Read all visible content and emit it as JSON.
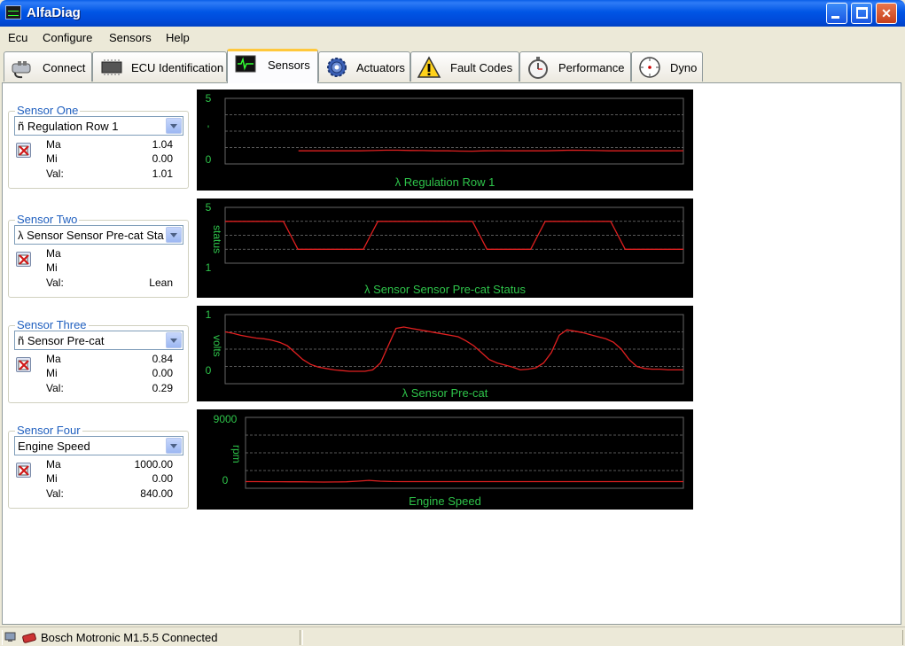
{
  "window": {
    "title": "AlfaDiag"
  },
  "menu": {
    "items": [
      "Ecu",
      "Configure",
      "Sensors",
      "Help"
    ]
  },
  "tabs": [
    {
      "label": "Connect",
      "icon": "plug-icon"
    },
    {
      "label": "ECU Identification",
      "icon": "chip-icon"
    },
    {
      "label": "Sensors",
      "icon": "oscilloscope-icon"
    },
    {
      "label": "Actuators",
      "icon": "gear-icon"
    },
    {
      "label": "Fault Codes",
      "icon": "warning-icon"
    },
    {
      "label": "Performance",
      "icon": "stopwatch-icon"
    },
    {
      "label": "Dyno",
      "icon": "dial-icon"
    }
  ],
  "active_tab": "Sensors",
  "sensors": [
    {
      "group_title": "Sensor One",
      "selected": "ñ Regulation Row 1",
      "ma_label": "Ma",
      "mi_label": "Mi",
      "val_label": "Val:",
      "ma": "1.04",
      "mi": "0.00",
      "val": "1.01"
    },
    {
      "group_title": "Sensor Two",
      "selected": "λ Sensor Sensor Pre-cat Status",
      "ma_label": "Ma",
      "mi_label": "Mi",
      "val_label": "Val:",
      "ma": "",
      "mi": "",
      "val": "Lean"
    },
    {
      "group_title": "Sensor Three",
      "selected": "ñ Sensor Pre-cat",
      "ma_label": "Ma",
      "mi_label": "Mi",
      "val_label": "Val:",
      "ma": "0.84",
      "mi": "0.00",
      "val": "0.29"
    },
    {
      "group_title": "Sensor Four",
      "selected": "Engine Speed",
      "ma_label": "Ma",
      "mi_label": "Mi",
      "val_label": "Val:",
      "ma": "1000.00",
      "mi": "0.00",
      "val": "840.00"
    }
  ],
  "charts": [
    {
      "title": "λ Regulation Row 1",
      "y_max_label": "5",
      "y_mid_label": "'",
      "y_min_label": "0",
      "y_axis_label": ""
    },
    {
      "title": "λ Sensor Sensor Pre-cat Status",
      "y_max_label": "5",
      "y_min_label": "1",
      "y_axis_label": "status"
    },
    {
      "title": "λ Sensor Pre-cat",
      "y_max_label": "1",
      "y_min_label": "0",
      "y_axis_label": "volts"
    },
    {
      "title": "Engine Speed",
      "y_max_label": "9000",
      "y_min_label": "0",
      "y_axis_label": "rpm"
    }
  ],
  "chart_data": [
    {
      "type": "line",
      "title": "λ Regulation Row 1",
      "ylim": [
        0,
        5
      ],
      "grid": true,
      "series": [
        {
          "values": [
            1.0,
            1.0,
            1.0,
            1.0,
            1.0,
            1.0,
            1.02,
            1.05,
            1.05,
            1.03,
            1.02,
            1.0,
            1.0,
            0.98,
            0.97,
            1.0,
            1.01,
            1.0,
            1.0,
            1.0,
            1.0,
            1.03,
            1.05,
            1.04,
            1.02,
            1.0,
            1.0,
            1.0,
            1.0,
            1.0,
            1.0,
            1.01
          ]
        }
      ],
      "line_color": "#e02020",
      "start_fraction": 0.16
    },
    {
      "type": "line",
      "title": "λ Sensor Sensor Pre-cat Status",
      "ylim": [
        1,
        5
      ],
      "grid": true,
      "series": [
        {
          "values": [
            4,
            4,
            4,
            4,
            4,
            4,
            4,
            4,
            4,
            3,
            2,
            2,
            2,
            2,
            2,
            2,
            2,
            2,
            2,
            2,
            3,
            4,
            4,
            4,
            4,
            4,
            4,
            4,
            4,
            4,
            4,
            4,
            4,
            4,
            4,
            3,
            2,
            2,
            2,
            2,
            2,
            2,
            2,
            3,
            4,
            4,
            4,
            4,
            4,
            4,
            4,
            4,
            4,
            4,
            3,
            2,
            2,
            2,
            2,
            2,
            2,
            2,
            2,
            2
          ]
        }
      ],
      "line_color": "#e02020"
    },
    {
      "type": "line",
      "title": "λ Sensor Pre-cat",
      "ylim": [
        0,
        1
      ],
      "grid": true,
      "series": [
        {
          "values": [
            0.75,
            0.73,
            0.7,
            0.68,
            0.66,
            0.65,
            0.63,
            0.6,
            0.55,
            0.45,
            0.35,
            0.28,
            0.24,
            0.22,
            0.2,
            0.19,
            0.18,
            0.18,
            0.18,
            0.2,
            0.3,
            0.55,
            0.8,
            0.82,
            0.8,
            0.78,
            0.76,
            0.74,
            0.72,
            0.7,
            0.68,
            0.62,
            0.55,
            0.45,
            0.35,
            0.3,
            0.27,
            0.24,
            0.2,
            0.21,
            0.23,
            0.3,
            0.45,
            0.7,
            0.78,
            0.76,
            0.74,
            0.71,
            0.68,
            0.65,
            0.6,
            0.5,
            0.35,
            0.25,
            0.22,
            0.21,
            0.21,
            0.2,
            0.2,
            0.2
          ]
        }
      ],
      "line_color": "#e02020"
    },
    {
      "type": "line",
      "title": "Engine Speed",
      "ylim": [
        0,
        9000
      ],
      "grid": true,
      "series": [
        {
          "values": [
            840,
            840,
            830,
            830,
            820,
            820,
            800,
            790,
            800,
            820,
            900,
            1000,
            900,
            850,
            840,
            840,
            840,
            840,
            840,
            840,
            840,
            840,
            840,
            840,
            840,
            840,
            840,
            840,
            840,
            840,
            840,
            840,
            840,
            840,
            840,
            840,
            840,
            840,
            840,
            840
          ]
        }
      ],
      "line_color": "#e02020"
    }
  ],
  "status": {
    "text": "Bosch Motronic M1.5.5 Connected"
  },
  "colors": {
    "chart_bg": "#000000",
    "chart_text": "#2ec44a",
    "chart_grid": "#555555",
    "line": "#e02020",
    "group_title": "#1f5fbf",
    "active_tab_accent": "#ffc83c"
  }
}
